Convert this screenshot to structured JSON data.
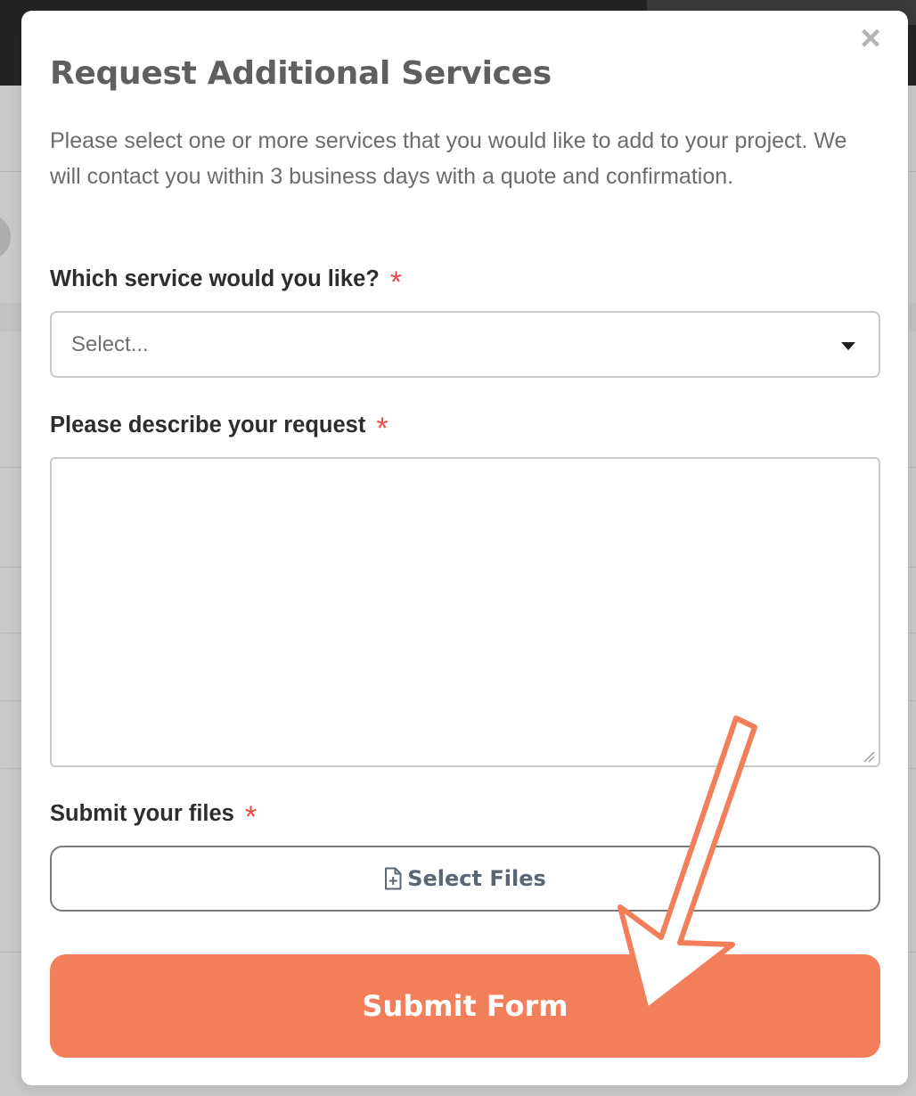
{
  "modal": {
    "title": "Request Additional Services",
    "description": "Please select one or more services that you would like to add to your project. We will contact you within 3 business days with a quote and confirmation.",
    "close_icon": "close-icon",
    "close_glyph": "×"
  },
  "form": {
    "service": {
      "label": "Which service would you like?",
      "required_mark": "*",
      "placeholder": "Select...",
      "icon": "caret-down-icon"
    },
    "description": {
      "label": "Please describe your request",
      "required_mark": "*",
      "value": ""
    },
    "files": {
      "label": "Submit your files",
      "required_mark": "*",
      "button_label": "Select Files",
      "icon": "file-plus-icon"
    },
    "submit": {
      "label": "Submit Form"
    }
  },
  "annotation": {
    "icon": "arrow-pointer-icon"
  },
  "colors": {
    "accent": "#f37e5a",
    "required": "#ec4a4a",
    "title": "#5f5f5f",
    "body_text": "#6c6c6c",
    "backdrop": "#c9c9c9",
    "topbar": "#232323"
  }
}
